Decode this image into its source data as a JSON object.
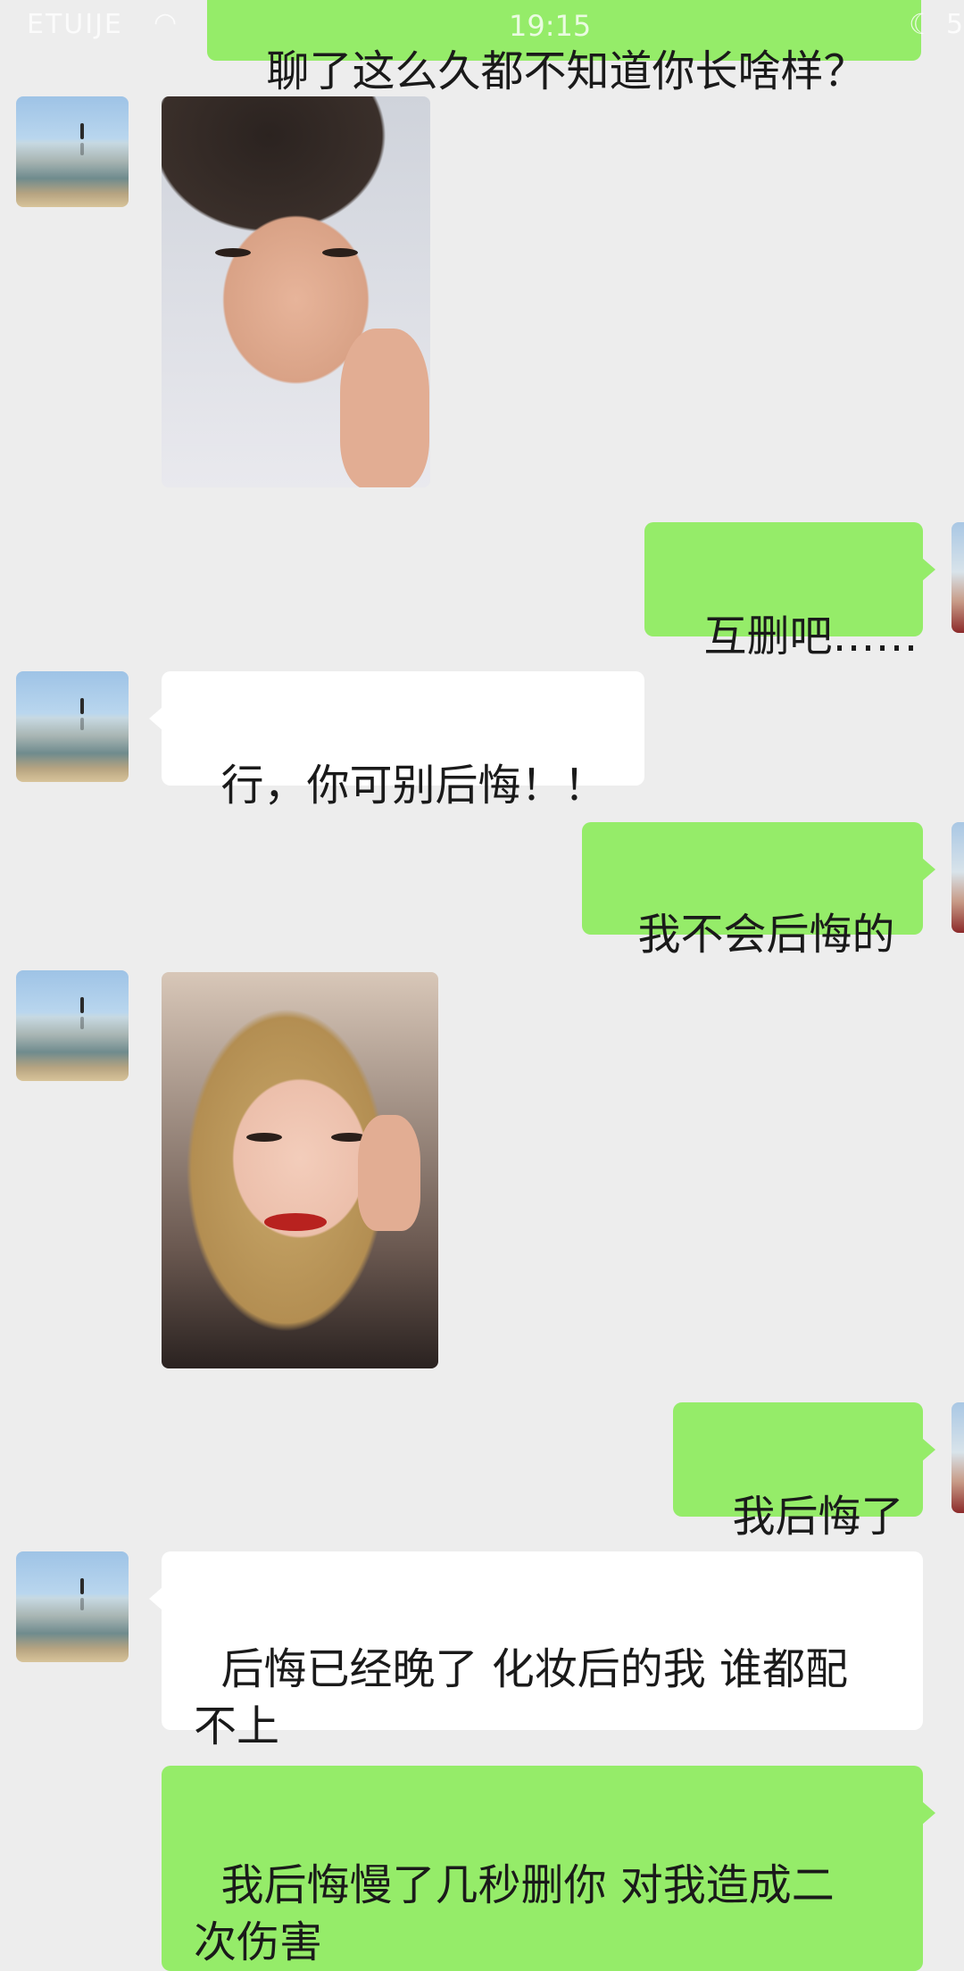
{
  "status_bar": {
    "carrier": "ETUIJE",
    "time": "19:15",
    "battery": "5"
  },
  "messages": [
    {
      "id": "m0",
      "side": "sent",
      "type": "text",
      "text": "聊了这么久都不知道你长啥样？"
    },
    {
      "id": "m1",
      "side": "received",
      "type": "image",
      "alt": "selfie-no-makeup"
    },
    {
      "id": "m2",
      "side": "sent",
      "type": "text",
      "text": "互删吧……"
    },
    {
      "id": "m3",
      "side": "received",
      "type": "text",
      "text": "行，你可别后悔！！"
    },
    {
      "id": "m4",
      "side": "sent",
      "type": "text",
      "text": "我不会后悔的"
    },
    {
      "id": "m5",
      "side": "received",
      "type": "image",
      "alt": "selfie-with-makeup"
    },
    {
      "id": "m6",
      "side": "sent",
      "type": "text",
      "text": "我后悔了"
    },
    {
      "id": "m7",
      "side": "received",
      "type": "text",
      "text": "后悔已经晚了 化妆后的我 谁都配\n不上"
    },
    {
      "id": "m8",
      "side": "sent",
      "type": "text",
      "text": "我后悔慢了几秒删你 对我造成二\n次伤害"
    }
  ],
  "colors": {
    "background": "#ededed",
    "sent_bubble": "#95ec69",
    "received_bubble": "#ffffff"
  },
  "icons": {
    "wifi": "wifi-icon",
    "moon": "moon-icon"
  }
}
